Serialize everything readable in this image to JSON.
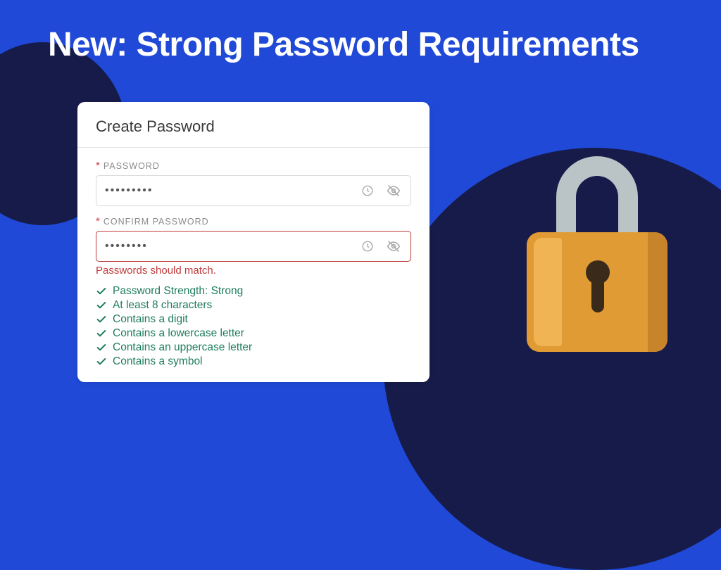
{
  "hero": {
    "title": "New: Strong Password Requirements"
  },
  "card": {
    "title": "Create Password",
    "password": {
      "label": "PASSWORD",
      "value": "•••••••••"
    },
    "confirm": {
      "label": "CONFIRM PASSWORD",
      "value": "••••••••",
      "error": "Passwords should match."
    },
    "checklist": [
      "Password Strength: Strong",
      "At least 8 characters",
      "Contains a digit",
      "Contains a lowercase letter",
      "Contains an uppercase letter",
      "Contains a symbol"
    ]
  },
  "colors": {
    "brand_blue": "#1f49d6",
    "navy": "#161b4a",
    "error_red": "#c03b3b",
    "success_green": "#1f7d5e",
    "lock_orange": "#e09b34"
  }
}
